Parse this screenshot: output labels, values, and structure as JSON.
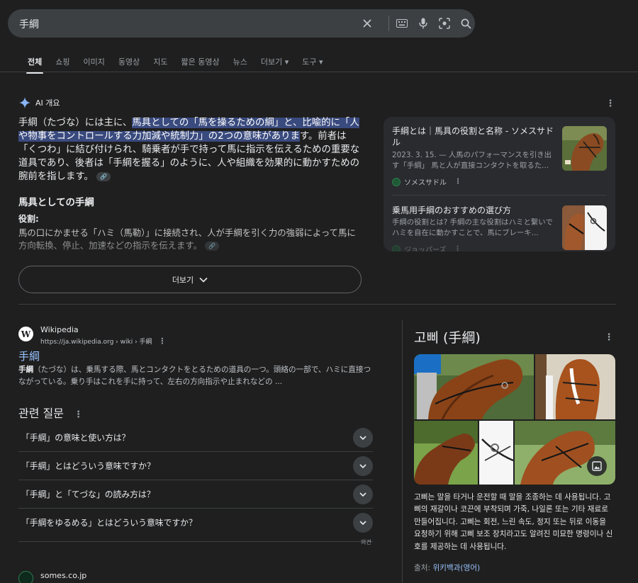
{
  "search": {
    "query": "手綱"
  },
  "tabs": [
    {
      "label": "전체",
      "active": true
    },
    {
      "label": "쇼핑"
    },
    {
      "label": "이미지"
    },
    {
      "label": "동영상"
    },
    {
      "label": "지도"
    },
    {
      "label": "짧은 동영상"
    },
    {
      "label": "뉴스"
    },
    {
      "label": "더보기 ▾"
    },
    {
      "label": "도구 ▾"
    }
  ],
  "ai_overview": {
    "heading": "AI 개요",
    "intro_plain_1": "手綱（たづな）には主に、",
    "intro_highlight": "馬具としての「馬を操るための綱」と、比喩的に「人や物事をコントロールする力加減や統制力」の2つの意味がありま",
    "intro_plain_2": "す。前者は「くつわ」に結び付けられ、騎乗者が手で持って馬に指示を伝えるための重要な道具であり、後者は「手綱を握る」のように、人や組織を効果的に動かすための腕前を指します。",
    "subheading": "馬具としての手綱",
    "role_label": "役割",
    "role_colon": ":",
    "role_text": "馬の口にかませる「ハミ（馬勒）」に接続され、人が手綱を引く力の強弱によって馬に方向転換、停止、加速などの指示を伝えます。",
    "more_button": "더보기"
  },
  "sources": [
    {
      "title": "手綱とは｜馬具の役割と名称 - ソメスサドル",
      "snippet": "2023. 3. 15. — 人馬のパフォーマンスを引き出す「手綱」 馬と人が直接コンタクトを取るた...",
      "site": "ソメスサドル"
    },
    {
      "title": "乗馬用手綱のおすすめの選び方",
      "snippet": "手綱の役割とは? 手綱の主な役割はハミと繋いでハミを自在に動かすことで、馬にブレーキ...",
      "site": "ジョッパーズ"
    }
  ],
  "wiki": {
    "favicon": "W",
    "name": "Wikipedia",
    "url": "https://ja.wikipedia.org › wiki › 手綱",
    "title": "手綱",
    "snippet_bold": "手綱",
    "snippet": "（たづな）は、乗馬する際、馬とコンタクトをとるための道具の一つ。頭絡の一部で、ハミに直接つながっている。乗り手はこれを手に持って、左右の方向指示や止まれなどの ..."
  },
  "paa": {
    "title": "관련 질문",
    "questions": [
      "「手綱」の意味と使い方は？",
      "「手綱」とはどういう意味ですか？",
      "「手綱」と「てづな」の読み方は？",
      "「手綱をゆるめる」とはどういう意味ですか？"
    ],
    "feedback": "의견"
  },
  "next_result": {
    "name": "somes.co.jp"
  },
  "knowledge_panel": {
    "title": "고삐 (手綱)",
    "description": "고삐는 말을 타거나 운전할 때 말을 조종하는 데 사용됩니다. 고삐의 재갈이나 코끈에 부착되며 가죽, 나일론 또는 기타 재료로 만들어집니다. 고삐는 회전, 느린 속도, 정지 또는 뒤로 이동을 요청하기 위해 고삐 보조 장치라고도 알려진 미묘한 명령이나 신호를 제공하는 데 사용됩니다.",
    "source_label": "출처:",
    "source_link": "위키백과(영어)"
  },
  "colors": {
    "background": "#1f1f1f",
    "highlight": "#394a7e",
    "link": "#99c3ff",
    "search_bar": "#3c4043"
  },
  "icons": [
    "clear-icon",
    "keyboard-icon",
    "mic-icon",
    "lens-icon",
    "search-icon",
    "sparkle-icon",
    "link-icon",
    "more-vert-icon",
    "chevron-down-icon",
    "image-icon"
  ]
}
